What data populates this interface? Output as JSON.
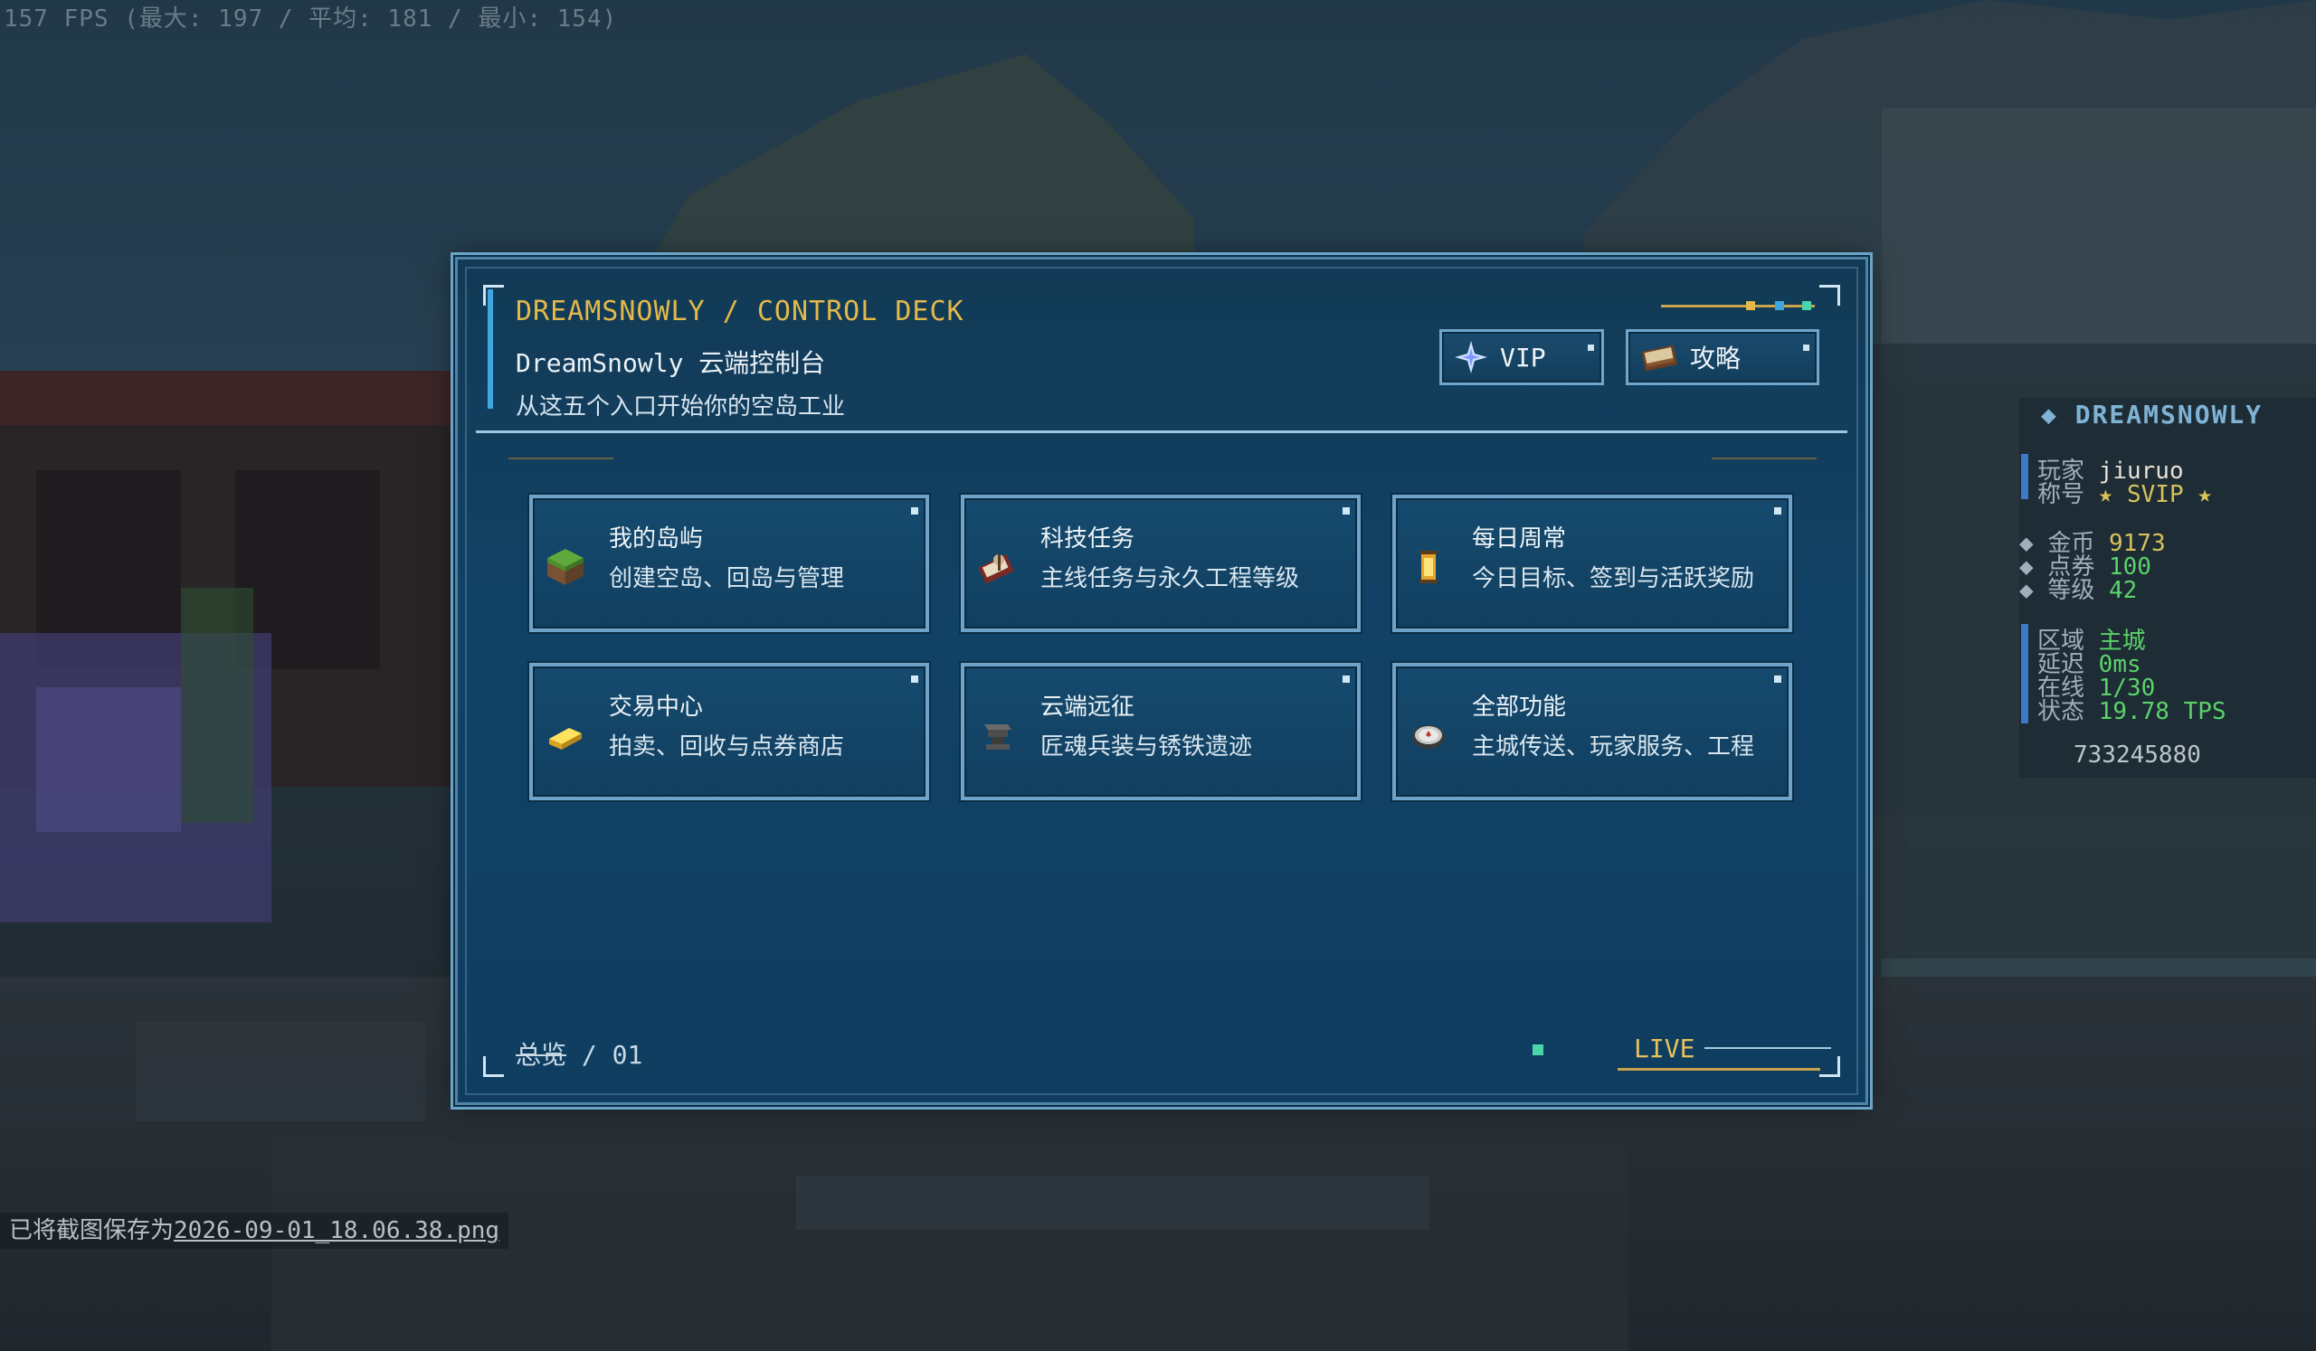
{
  "hud": {
    "fps": "157 FPS (最大: 197 / 平均: 181 / 最小: 154)",
    "chat_prefix": "已将截图保存为",
    "chat_file": "2026-09-01_18.06.38.png"
  },
  "scoreboard": {
    "title": "DREAMSNOWLY",
    "player_key": "玩家",
    "player_val": "jiuruo",
    "rank_key": "称号",
    "rank_val": "SVIP",
    "gold_key": "金币",
    "gold_val": "9173",
    "points_key": "点券",
    "points_val": "100",
    "level_key": "等级",
    "level_val": "42",
    "zone_key": "区域",
    "zone_val": "主城",
    "ping_key": "延迟",
    "ping_val": "0ms",
    "online_key": "在线",
    "online_val": "1/30",
    "status_key": "状态",
    "status_val": "19.78 TPS",
    "uid": "733245880"
  },
  "panel": {
    "title": "DREAMSNOWLY / CONTROL DECK",
    "name": "DreamSnowly 云端控制台",
    "subtitle": "从这五个入口开始你的空岛工业",
    "vip_label": "VIP",
    "guide_label": "攻略",
    "footer_left_a": "总览",
    "footer_left_b": " / 01",
    "footer_right": "LIVE"
  },
  "cards": [
    {
      "title": "我的岛屿",
      "subtitle": "创建空岛、回岛与管理",
      "icon": "grass-block-icon"
    },
    {
      "title": "科技任务",
      "subtitle": "主线任务与永久工程等级",
      "icon": "quest-book-icon"
    },
    {
      "title": "每日周常",
      "subtitle": "今日目标、签到与活跃奖励",
      "icon": "lantern-scroll-icon"
    },
    {
      "title": "交易中心",
      "subtitle": "拍卖、回收与点券商店",
      "icon": "gold-ingot-icon"
    },
    {
      "title": "云端远征",
      "subtitle": "匠魂兵装与锈铁遗迹",
      "icon": "anvil-icon"
    },
    {
      "title": "全部功能",
      "subtitle": "主城传送、玩家服务、工程",
      "icon": "compass-icon"
    }
  ],
  "colors": {
    "accent_gold": "#e2b94a",
    "panel_blue": "#114266",
    "border_blue": "#6ea4c9",
    "live_green": "#49d6a8"
  }
}
